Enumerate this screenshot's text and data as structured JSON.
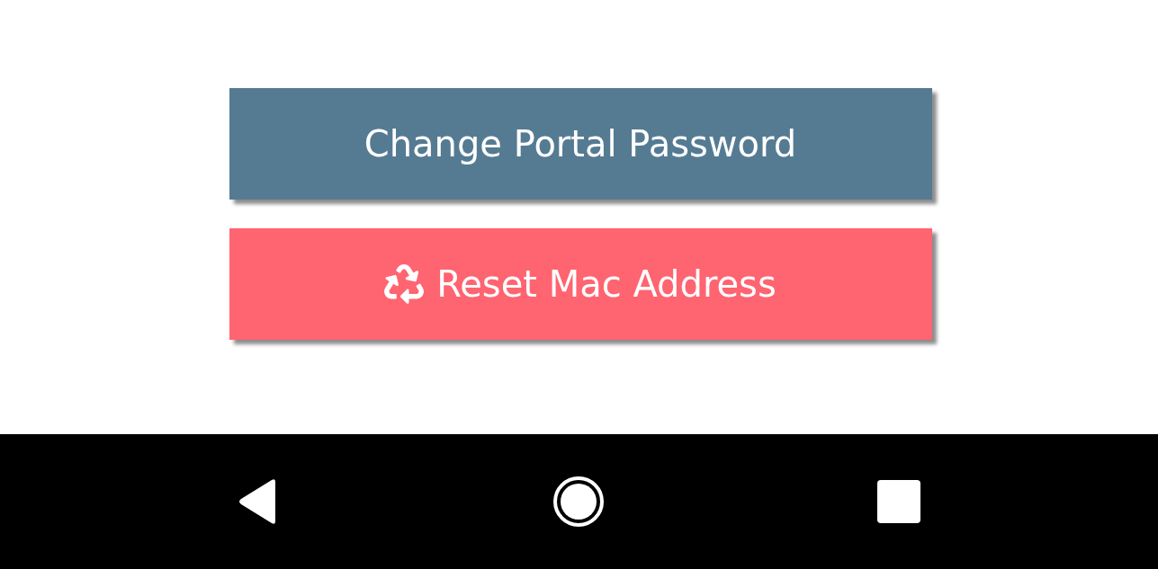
{
  "buttons": [
    {
      "label": "Change Portal Password",
      "kind": "primary"
    },
    {
      "label": "Reset Mac Address",
      "kind": "reset"
    }
  ]
}
